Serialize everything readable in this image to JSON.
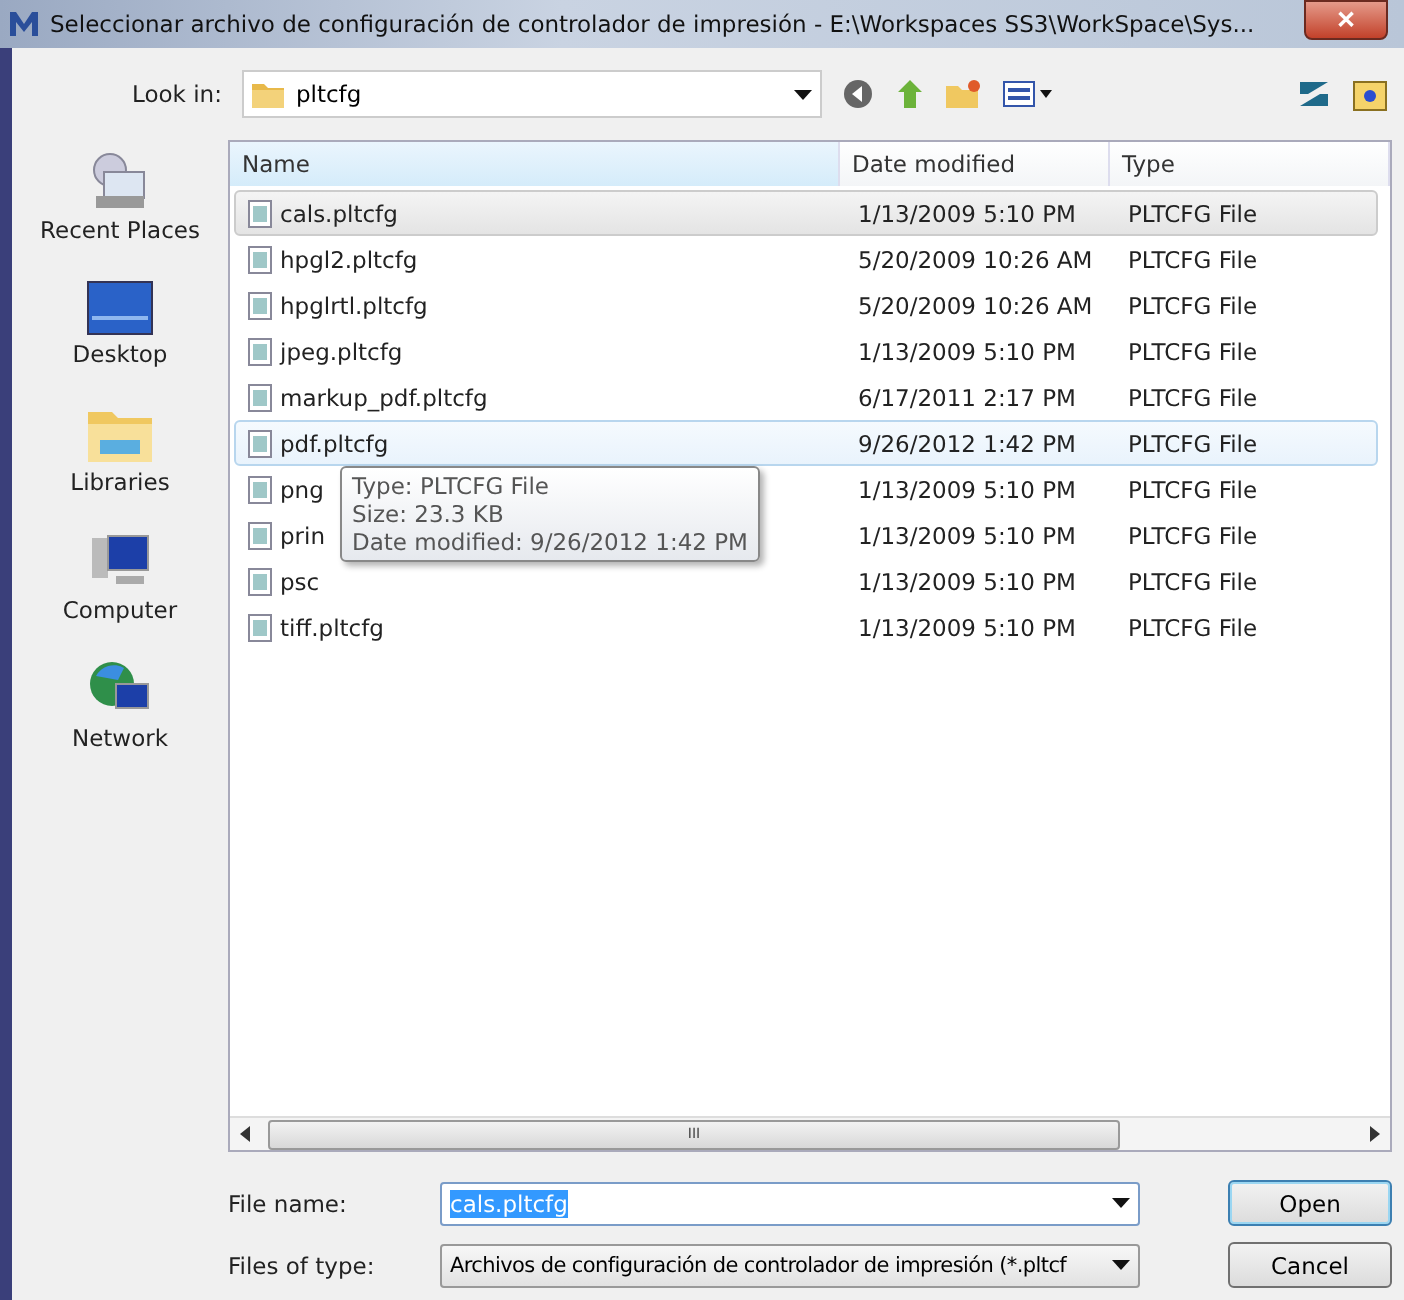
{
  "window": {
    "title": "Seleccionar archivo de configuración de controlador de impresión - E:\\Workspaces SS3\\WorkSpace\\Sys...",
    "close": "✕"
  },
  "toolbar": {
    "look_in_label": "Look in:",
    "look_in_value": "pltcfg"
  },
  "places": [
    {
      "label": "Recent Places",
      "kind": "recent"
    },
    {
      "label": "Desktop",
      "kind": "desktop"
    },
    {
      "label": "Libraries",
      "kind": "libraries"
    },
    {
      "label": "Computer",
      "kind": "computer"
    },
    {
      "label": "Network",
      "kind": "network"
    }
  ],
  "table": {
    "columns": [
      "Name",
      "Date modified",
      "Type"
    ],
    "rows": [
      {
        "name": "cals.pltcfg",
        "date": "1/13/2009 5:10 PM",
        "type": "PLTCFG File",
        "selected": true,
        "hovered": false
      },
      {
        "name": "hpgl2.pltcfg",
        "date": "5/20/2009 10:26 AM",
        "type": "PLTCFG File",
        "selected": false,
        "hovered": false
      },
      {
        "name": "hpglrtl.pltcfg",
        "date": "5/20/2009 10:26 AM",
        "type": "PLTCFG File",
        "selected": false,
        "hovered": false
      },
      {
        "name": "jpeg.pltcfg",
        "date": "1/13/2009 5:10 PM",
        "type": "PLTCFG File",
        "selected": false,
        "hovered": false
      },
      {
        "name": "markup_pdf.pltcfg",
        "date": "6/17/2011 2:17 PM",
        "type": "PLTCFG File",
        "selected": false,
        "hovered": false
      },
      {
        "name": "pdf.pltcfg",
        "date": "9/26/2012 1:42 PM",
        "type": "PLTCFG File",
        "selected": false,
        "hovered": true
      },
      {
        "name": "png",
        "date": "1/13/2009 5:10 PM",
        "type": "PLTCFG File",
        "selected": false,
        "hovered": false
      },
      {
        "name": "prin",
        "date": "1/13/2009 5:10 PM",
        "type": "PLTCFG File",
        "selected": false,
        "hovered": false
      },
      {
        "name": "psc",
        "date": "1/13/2009 5:10 PM",
        "type": "PLTCFG File",
        "selected": false,
        "hovered": false
      },
      {
        "name": "tiff.pltcfg",
        "date": "1/13/2009 5:10 PM",
        "type": "PLTCFG File",
        "selected": false,
        "hovered": false
      }
    ]
  },
  "tooltip": [
    "Type: PLTCFG File",
    "Size: 23.3 KB",
    "Date modified: 9/26/2012 1:42 PM"
  ],
  "scrollbar_grip": "III",
  "file_name": {
    "label": "File name:",
    "value": "cals.pltcfg"
  },
  "file_type": {
    "label": "Files of type:",
    "value": "Archivos de configuración de controlador de impresión (*.pltcf"
  },
  "buttons": [
    "Open",
    "Cancel"
  ]
}
